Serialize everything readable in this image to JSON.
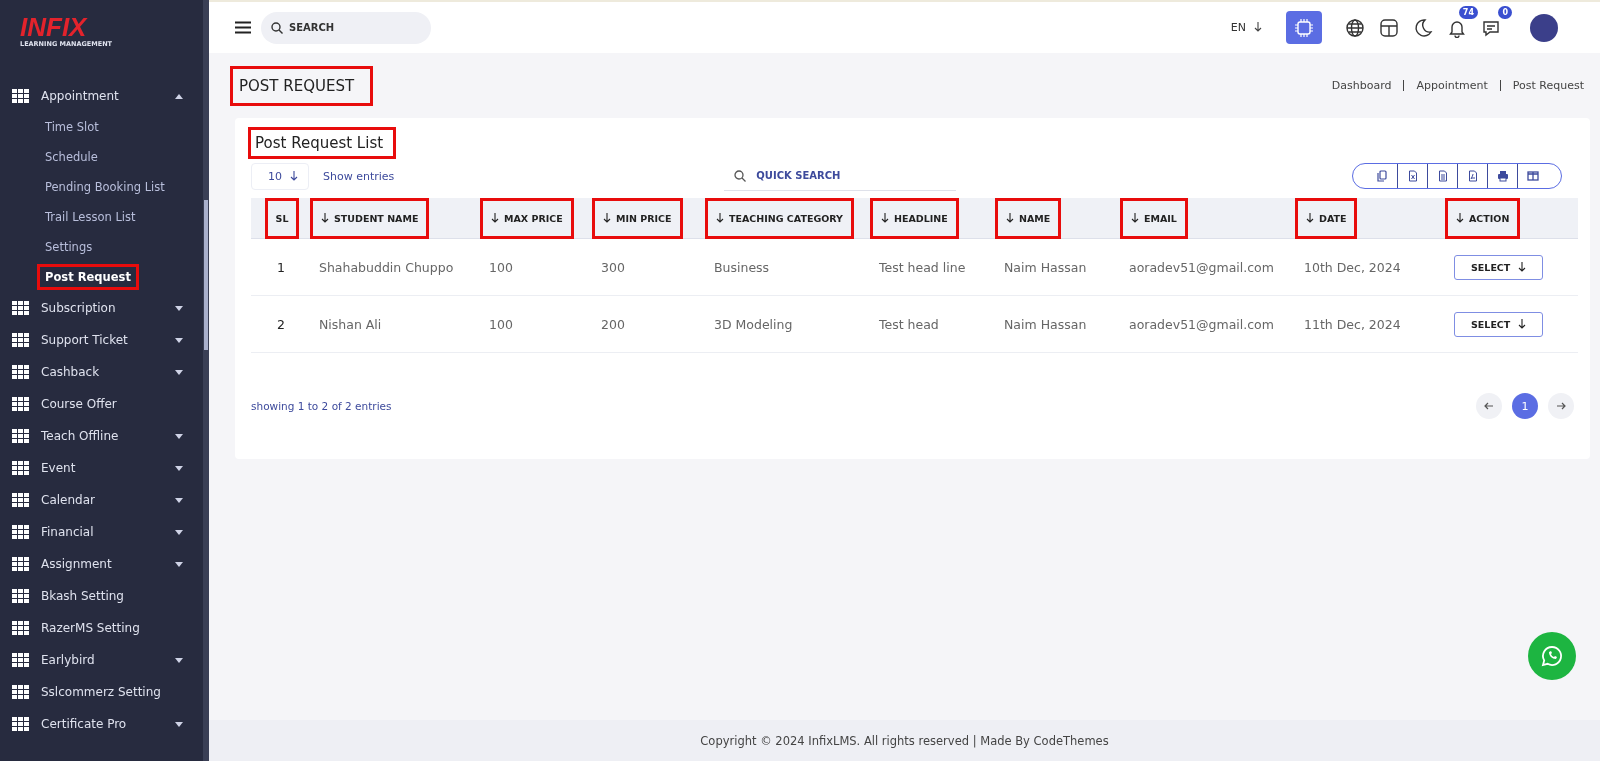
{
  "logo": {
    "title": "INFIX",
    "subtitle": "LEARNING MANAGEMENT"
  },
  "sidebar": {
    "items": [
      {
        "label": "Appointment",
        "has_caret": true,
        "expanded": true,
        "children": [
          {
            "label": "Time Slot",
            "selected": false,
            "highlighted": false
          },
          {
            "label": "Schedule",
            "selected": false,
            "highlighted": false
          },
          {
            "label": "Pending Booking List",
            "selected": false,
            "highlighted": false
          },
          {
            "label": "Trail Lesson List",
            "selected": false,
            "highlighted": false
          },
          {
            "label": "Settings",
            "selected": false,
            "highlighted": false
          },
          {
            "label": "Post Request",
            "selected": true,
            "highlighted": true
          }
        ]
      },
      {
        "label": "Subscription",
        "has_caret": true,
        "expanded": false
      },
      {
        "label": "Support Ticket",
        "has_caret": true,
        "expanded": false
      },
      {
        "label": "Cashback",
        "has_caret": true,
        "expanded": false
      },
      {
        "label": "Course Offer",
        "has_caret": false
      },
      {
        "label": "Teach Offline",
        "has_caret": true,
        "expanded": false
      },
      {
        "label": "Event",
        "has_caret": true,
        "expanded": false
      },
      {
        "label": "Calendar",
        "has_caret": true,
        "expanded": false
      },
      {
        "label": "Financial",
        "has_caret": true,
        "expanded": false
      },
      {
        "label": "Assignment",
        "has_caret": true,
        "expanded": false
      },
      {
        "label": "Bkash Setting",
        "has_caret": false
      },
      {
        "label": "RazerMS Setting",
        "has_caret": false
      },
      {
        "label": "Earlybird",
        "has_caret": true,
        "expanded": false
      },
      {
        "label": "Sslcommerz Setting",
        "has_caret": false
      },
      {
        "label": "Certificate Pro",
        "has_caret": true,
        "expanded": false
      }
    ]
  },
  "topbar": {
    "search_placeholder": "SEARCH",
    "language": "EN",
    "notifications_badge": "74",
    "messages_badge": "0"
  },
  "page": {
    "title": "POST REQUEST",
    "title_highlighted": true,
    "breadcrumb": [
      "Dashboard",
      "Appointment",
      "Post Request"
    ]
  },
  "card": {
    "title": "Post Request List",
    "title_highlighted": true,
    "page_size": "10",
    "page_size_label": "Show entries",
    "quick_search_placeholder": "QUICK SEARCH",
    "export_buttons": [
      {
        "kind": "copy"
      },
      {
        "kind": "excel"
      },
      {
        "kind": "csv"
      },
      {
        "kind": "pdf"
      },
      {
        "kind": "print"
      },
      {
        "kind": "columns"
      }
    ]
  },
  "table": {
    "columns": [
      {
        "label": "SL",
        "sortable": false,
        "highlighted": true
      },
      {
        "label": "STUDENT NAME",
        "sortable": true,
        "highlighted": true
      },
      {
        "label": "MAX PRICE",
        "sortable": true,
        "highlighted": true
      },
      {
        "label": "MIN PRICE",
        "sortable": true,
        "highlighted": true
      },
      {
        "label": "TEACHING CATEGORY",
        "sortable": true,
        "highlighted": true
      },
      {
        "label": "HEADLINE",
        "sortable": true,
        "highlighted": true
      },
      {
        "label": "NAME",
        "sortable": true,
        "highlighted": true
      },
      {
        "label": "EMAIL",
        "sortable": true,
        "highlighted": true
      },
      {
        "label": "DATE",
        "sortable": true,
        "highlighted": true
      },
      {
        "label": "ACTION",
        "sortable": true,
        "highlighted": true
      }
    ],
    "rows": [
      {
        "cells": [
          "1",
          "Shahabuddin Chuppo",
          "100",
          "300",
          "Business",
          "Test head line",
          "Naim Hassan",
          "aoradev51@gmail.com",
          "10th Dec, 2024"
        ],
        "action": "SELECT"
      },
      {
        "cells": [
          "2",
          "Nishan Ali",
          "100",
          "200",
          "3D Modeling",
          "Test head",
          "Naim Hassan",
          "aoradev51@gmail.com",
          "11th Dec, 2024"
        ],
        "action": "SELECT"
      }
    ]
  },
  "pagination": {
    "summary": "showing 1 to 2 of 2 entries",
    "pages": [
      {
        "label": "1",
        "selected": true
      }
    ]
  },
  "footer": "Copyright © 2024 InfixLMS. All rights reserved | Made By CodeThemes"
}
